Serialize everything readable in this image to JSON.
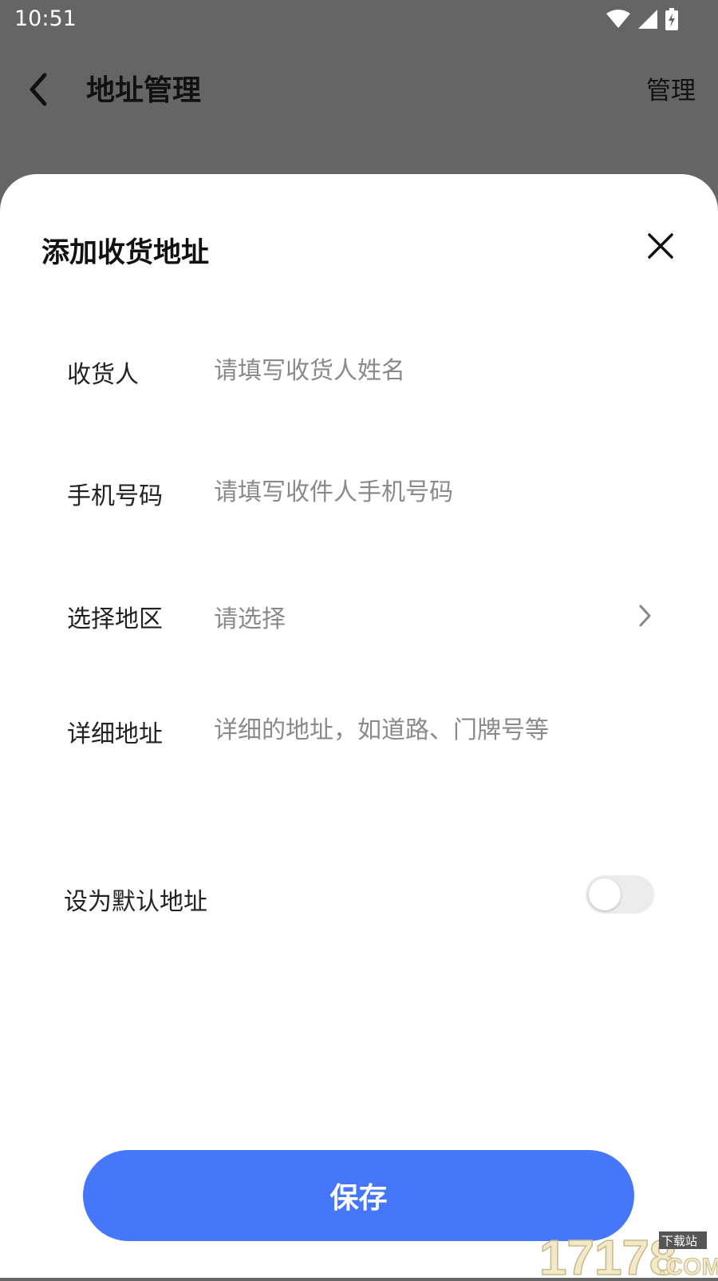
{
  "status_bar": {
    "time": "10:51",
    "icons": [
      "wifi-icon",
      "cellular-signal-icon",
      "battery-charging-icon"
    ],
    "icon_color": "#ffffff"
  },
  "header": {
    "back_icon": "chevron-left-icon",
    "title": "地址管理",
    "action_label": "管理"
  },
  "sheet": {
    "title": "添加收货地址",
    "close_icon": "close-icon",
    "fields": [
      {
        "label": "收货人",
        "value": "",
        "placeholder": "请填写收货人姓名"
      },
      {
        "label": "手机号码",
        "value": "",
        "placeholder": "请填写收件人手机号码"
      },
      {
        "label": "选择地区",
        "value": "请选择",
        "icon": "chevron-right-icon"
      },
      {
        "label": "详细地址",
        "value": "",
        "placeholder": "详细的地址，如道路、门牌号等"
      }
    ],
    "default_address": {
      "label": "设为默认地址",
      "enabled": false
    },
    "save_label": "保存"
  },
  "colors": {
    "overlay": "#656565",
    "sheet_background": "#ffffff",
    "primary": "#4677fb",
    "placeholder": "#8a8a8a",
    "toggle_off": "#ececec"
  },
  "watermark": {
    "number": "17178",
    "suffix": ".COM",
    "tag": "下载站"
  }
}
